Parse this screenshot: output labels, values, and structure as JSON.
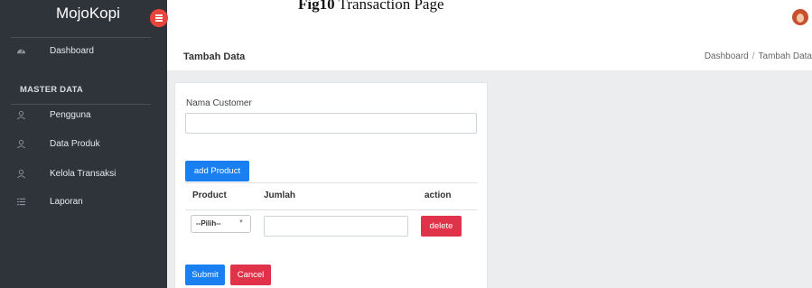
{
  "caption": {
    "bold": "Fig10",
    "text": " Transaction Page"
  },
  "brand": {
    "name": "MojoKopi"
  },
  "sidebar": {
    "dashboard_label": "Dashboard",
    "section_title": "MASTER DATA",
    "items": [
      {
        "label": "Pengguna",
        "icon": "user-icon"
      },
      {
        "label": "Data Produk",
        "icon": "user-icon"
      },
      {
        "label": "Kelola Transaksi",
        "icon": "user-icon"
      },
      {
        "label": "Laporan",
        "icon": "list-icon"
      }
    ]
  },
  "header": {
    "title": "Tambah Data",
    "breadcrumb": [
      "Dashboard",
      "Tambah Data"
    ]
  },
  "form": {
    "customer_label": "Nama Customer",
    "customer_value": "",
    "add_product_label": "add Product",
    "columns": [
      "Product",
      "Jumlah",
      "action"
    ],
    "row": {
      "product_selected": "--Pilih--",
      "quantity": "",
      "delete_label": "delete"
    },
    "submit_label": "Submit",
    "cancel_label": "Cancel"
  },
  "colors": {
    "sidebar_bg": "#2f343b",
    "primary": "#1a7ff0",
    "danger": "#e0334a",
    "toggle": "#e8453c"
  }
}
